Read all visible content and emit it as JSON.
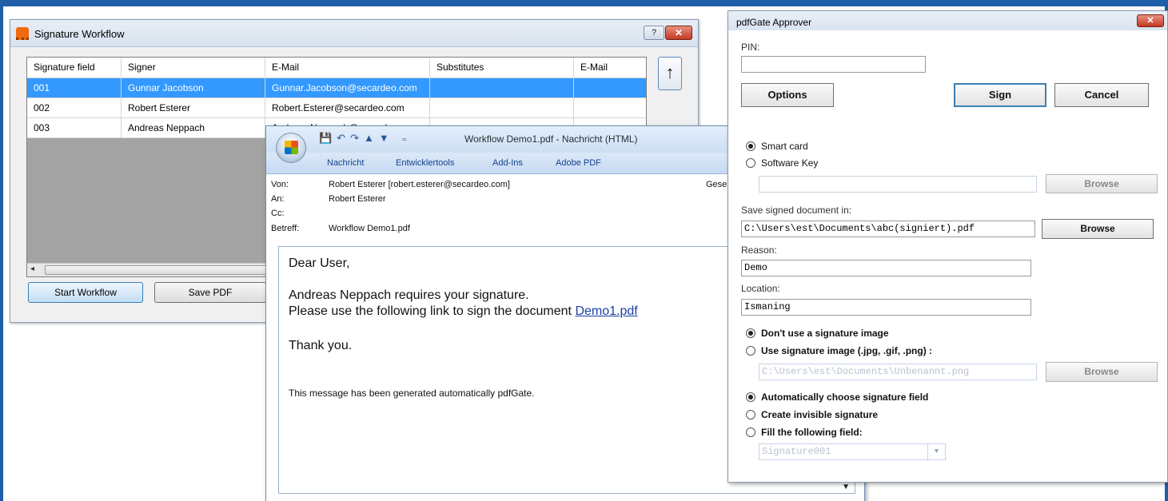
{
  "signature_workflow": {
    "title": "Signature Workflow",
    "help_label": "?",
    "close_label": "✕",
    "columns": [
      "Signature field",
      "Signer",
      "E-Mail",
      "Substitutes",
      "E-Mail"
    ],
    "rows": [
      {
        "field": "001",
        "signer": "Gunnar Jacobson",
        "email": "Gunnar.Jacobson@secardeo.com",
        "substitutes": "",
        "email2": ""
      },
      {
        "field": "002",
        "signer": "Robert Esterer",
        "email": "Robert.Esterer@secardeo.com",
        "substitutes": "",
        "email2": ""
      },
      {
        "field": "003",
        "signer": "Andreas Neppach",
        "email": "Andreas.Neppach@secardeo.com",
        "substitutes": "",
        "email2": ""
      }
    ],
    "up_label": "↑",
    "scroll_left": "◂",
    "start_label": "Start Workflow",
    "save_pdf_label": "Save PDF"
  },
  "mail": {
    "title": "Workflow Demo1.pdf - Nachricht (HTML)",
    "qat": "💾↶↷▲▼ ₌",
    "tabs": [
      "Nachricht",
      "Entwicklertools",
      "Add-Ins",
      "Adobe PDF"
    ],
    "from_label": "Von:",
    "from_value": "Robert Esterer [robert.esterer@secardeo.com]",
    "to_label": "An:",
    "to_value": "Robert Esterer",
    "cc_label": "Cc:",
    "subject_label": "Betreff:",
    "subject_value": "Workflow Demo1.pdf",
    "right_cut": "Gese",
    "body": {
      "greeting": "Dear User,",
      "line1": "Andreas Neppach requires your signature.",
      "line2_prefix": "Please use the following link to sign the document ",
      "link": "Demo1.pdf",
      "thanks": "Thank you.",
      "footer": "This message has been generated automatically pdfGate."
    },
    "scroll_arrow": "▼"
  },
  "approver": {
    "title": "pdfGate Approver",
    "close_label": "✕",
    "pin_label": "PIN:",
    "pin_value": "",
    "options_label": "Options",
    "sign_label": "Sign",
    "cancel_label": "Cancel",
    "smart_card": "Smart card",
    "software_key": "Software Key",
    "software_key_path": "",
    "browse_label": "Browse",
    "save_in_label": "Save signed document in:",
    "save_in_value": "C:\\Users\\est\\Documents\\abc(signiert).pdf",
    "reason_label": "Reason:",
    "reason_value": "Demo",
    "location_label": "Location:",
    "location_value": "Ismaning",
    "no_image": "Don't use a signature image",
    "use_image": "Use signature image (.jpg, .gif, .png) :",
    "image_path": "C:\\Users\\est\\Documents\\Unbenannt.png",
    "auto_field": "Automatically choose signature field",
    "invisible": "Create invisible signature",
    "fill_field": "Fill the following field:",
    "field_value": "Signature001",
    "combo_arrow": "▼"
  }
}
